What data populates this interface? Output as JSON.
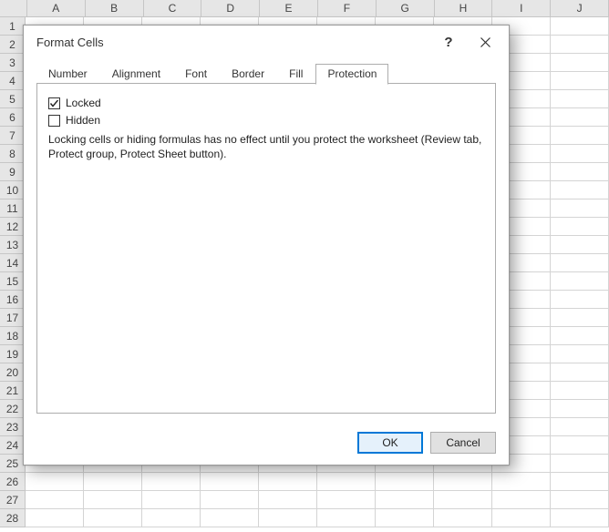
{
  "columns": [
    "A",
    "B",
    "C",
    "D",
    "E",
    "F",
    "G",
    "H",
    "I",
    "J"
  ],
  "rows": [
    "1",
    "2",
    "3",
    "4",
    "5",
    "6",
    "7",
    "8",
    "9",
    "10",
    "11",
    "12",
    "13",
    "14",
    "15",
    "16",
    "17",
    "18",
    "19",
    "20",
    "21",
    "22",
    "23",
    "24",
    "25",
    "26",
    "27",
    "28"
  ],
  "dialog": {
    "title": "Format Cells",
    "tabs": {
      "number": "Number",
      "alignment": "Alignment",
      "font": "Font",
      "border": "Border",
      "fill": "Fill",
      "protection": "Protection"
    },
    "protection": {
      "locked_label": "Locked",
      "hidden_label": "Hidden",
      "help_text": "Locking cells or hiding formulas has no effect until you protect the worksheet (Review tab, Protect group, Protect Sheet button)."
    },
    "buttons": {
      "ok": "OK",
      "cancel": "Cancel"
    }
  }
}
